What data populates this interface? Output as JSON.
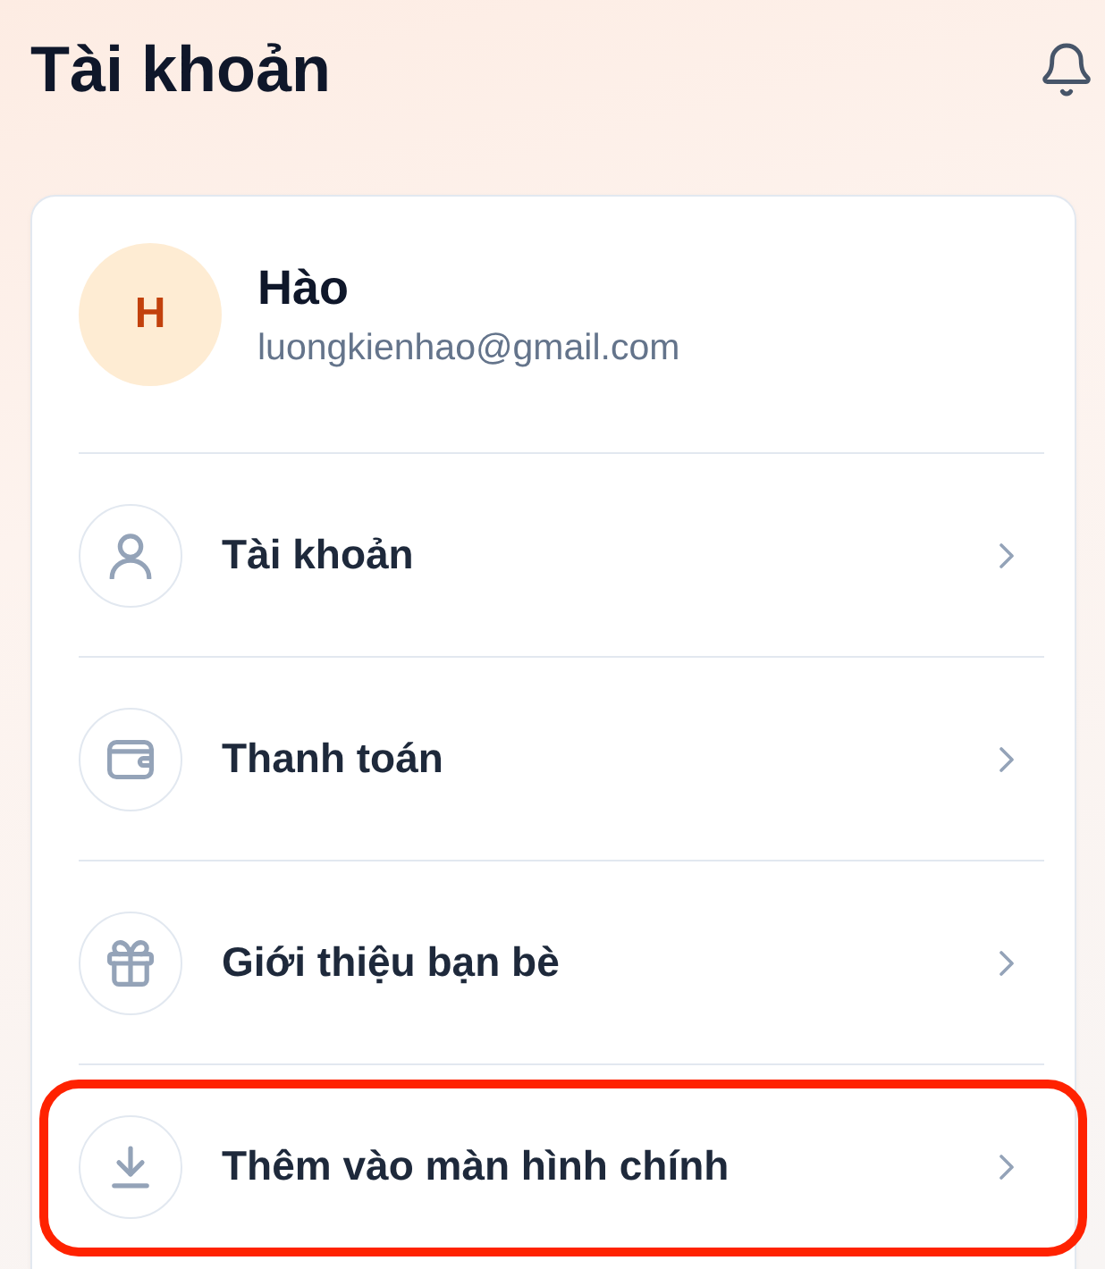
{
  "header": {
    "title": "Tài khoản"
  },
  "profile": {
    "initial": "H",
    "name": "Hào",
    "email": "luongkienhao@gmail.com"
  },
  "menu": [
    {
      "kind": "user",
      "label": "Tài khoản",
      "highlighted": false
    },
    {
      "kind": "wallet",
      "label": "Thanh toán",
      "highlighted": false
    },
    {
      "kind": "gift",
      "label": "Giới thiệu bạn bè",
      "highlighted": false
    },
    {
      "kind": "download",
      "label": "Thêm vào màn hình chính",
      "highlighted": true
    }
  ]
}
